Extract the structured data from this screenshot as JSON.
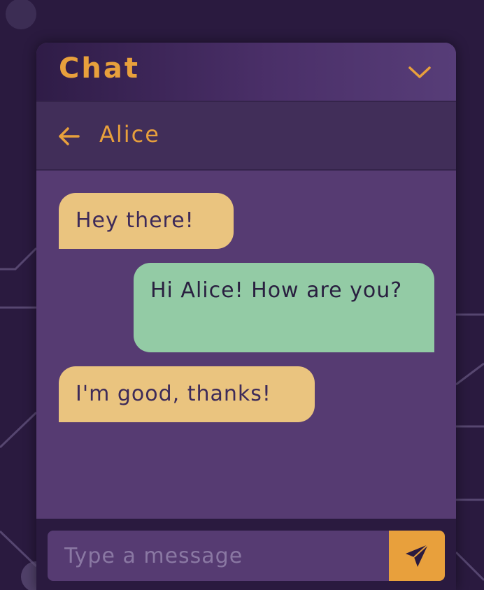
{
  "header": {
    "title": "Chat",
    "collapse_icon": "chevron-down-icon"
  },
  "conversation": {
    "back_icon": "arrow-left-icon",
    "contact_name": "Alice"
  },
  "messages": [
    {
      "direction": "incoming",
      "text": "Hey there!"
    },
    {
      "direction": "outgoing",
      "text": "Hi Alice! How are you?"
    },
    {
      "direction": "incoming",
      "text": "I'm good, thanks!"
    }
  ],
  "composer": {
    "placeholder": "Type a message",
    "value": "",
    "send_icon": "send-paper-plane-icon"
  },
  "colors": {
    "background": "#2a1a3f",
    "panel": "#563b72",
    "accent": "#e8a03c",
    "incoming_bubble": "#eac47f",
    "outgoing_bubble": "#93cba5"
  }
}
